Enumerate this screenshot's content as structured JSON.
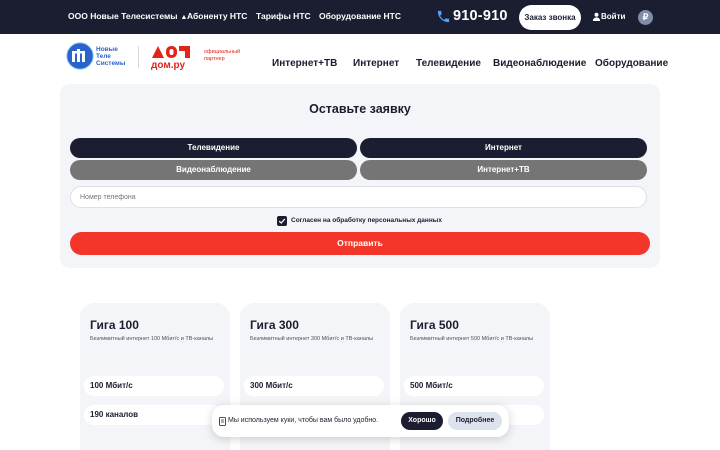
{
  "topbar": {
    "company": "ООО Новые Телесистемы",
    "company_caret": "▲",
    "links": [
      "Абоненту НТС",
      "Тарифы НТС",
      "Оборудование НТС"
    ],
    "phone": "910-910",
    "callback_label": "Заказ звонка",
    "login_label": "Войти",
    "currency_symbol": "₽"
  },
  "header": {
    "logo_nts_text": "Новые\nТеле\nСистемы",
    "logo_domru_text": "дом.ру",
    "partner_text": "официальный\nпартнер",
    "nav": [
      "Интернет+ТВ",
      "Интернет",
      "Телевидение",
      "Видеонаблюдение",
      "Оборудование"
    ]
  },
  "form": {
    "title": "Оставьте заявку",
    "services": [
      "Телевидение",
      "Интернет",
      "Видеонаблюдение",
      "Интернет+ТВ"
    ],
    "phone_placeholder": "Номер телефона",
    "consent_label": "Согласен на обработку персональных данных",
    "consent_checked": true,
    "submit_label": "Отправить"
  },
  "tariffs": [
    {
      "name": "Гига 100",
      "description": "Безлимитный интернет 100 Мбит/с и ТВ-каналы",
      "speed": "100 Мбит/с",
      "channels": "190 каналов"
    },
    {
      "name": "Гига 300",
      "description": "Безлимитный интернет 300 Мбит/с и ТВ-каналы",
      "speed": "300 Мбит/с",
      "channels": ""
    },
    {
      "name": "Гига 500",
      "description": "Безлимитный интернет 500 Мбит/с и ТВ-каналы",
      "speed": "500 Мбит/с",
      "channels": ""
    }
  ],
  "cookie": {
    "text": "Мы используем куки, чтобы вам было удобно.",
    "ok_label": "Хорошо",
    "more_label": "Подробнее"
  },
  "colors": {
    "topbar_bg": "#1b1e30",
    "accent_red": "#f4362a",
    "brand_blue": "#2b63c9",
    "panel_bg": "#f4f5f8",
    "service_grey": "#757575"
  },
  "icons": {
    "phone": "phone-icon",
    "user": "user-icon",
    "ruble": "ruble-icon",
    "check": "check-icon",
    "cookie": "cookie-icon",
    "caret": "caret-up-icon"
  }
}
